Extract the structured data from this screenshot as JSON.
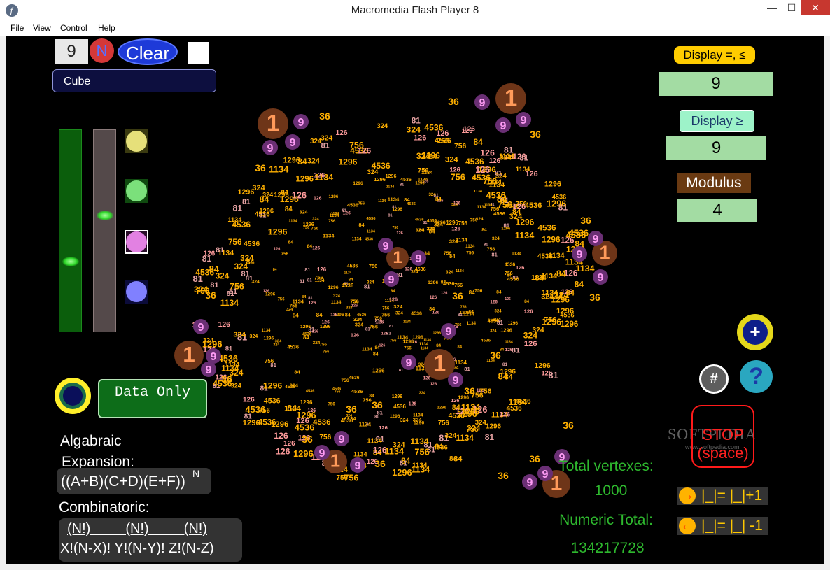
{
  "window": {
    "title": "Macromedia Flash Player 8",
    "minimize_glyph": "—",
    "maximize_glyph": "☐",
    "close_glyph": "✕",
    "icon": "flash-player-icon"
  },
  "menu": {
    "items": [
      "File",
      "View",
      "Control",
      "Help"
    ]
  },
  "controls": {
    "n_value": "9",
    "n_label": "N",
    "clear_label": "Clear",
    "shape_value": "Cube",
    "data_only_label": "Data Only"
  },
  "sliders": {
    "left_level": 0.34,
    "right_level": 0.58
  },
  "color_swatches": [
    "#e6e07a",
    "#7be07b",
    "#e281e2",
    "#8080ff"
  ],
  "text_blocks": {
    "algebraic_line1": "Algabraic",
    "algebraic_line2": "Expansion:",
    "algebraic_formula": "((A+B)(C+D)(E+F))",
    "algebraic_exponent": "N",
    "combinatoric_label": "Combinatoric:",
    "comb_top": "(N!)         (N!)         (N!)",
    "comb_bottom": "X!(N-X)! Y!(N-Y)! Z!(N-Z)"
  },
  "right_panel": {
    "display_eq_label": "Display =, ≤",
    "display_eq_value": "9",
    "display_ge_label": "Display ≥",
    "display_ge_value": "9",
    "modulus_label": "Modulus",
    "modulus_value": "4",
    "plus_glyph": "+",
    "hash_glyph": "#",
    "help_glyph": "?",
    "stop_line1": "STOP",
    "stop_line2": "(space)",
    "total_vertexes_label": "Total vertexes:",
    "total_vertexes_value": "1000",
    "numeric_total_label": "Numeric Total:",
    "numeric_total_value": "134217728",
    "step_forward_label": "|_|= |_|+1",
    "step_back_label": "|_|= |_| -1",
    "watermark": "SOFTPEDIA",
    "watermark_url": "www.softpedia.com"
  },
  "visualization": {
    "description_numbers": [
      "1",
      "9",
      "36",
      "81",
      "84",
      "126",
      "324",
      "756",
      "1134",
      "1296",
      "4536"
    ],
    "vertex_colors": {
      "1": "#6e3518",
      "9": "#6a2f74",
      "36": "#ffb000",
      "81": "#e7a3a3",
      "84": "#ffb000",
      "126": "#ff9c9c",
      "other": "#ffb000"
    }
  }
}
